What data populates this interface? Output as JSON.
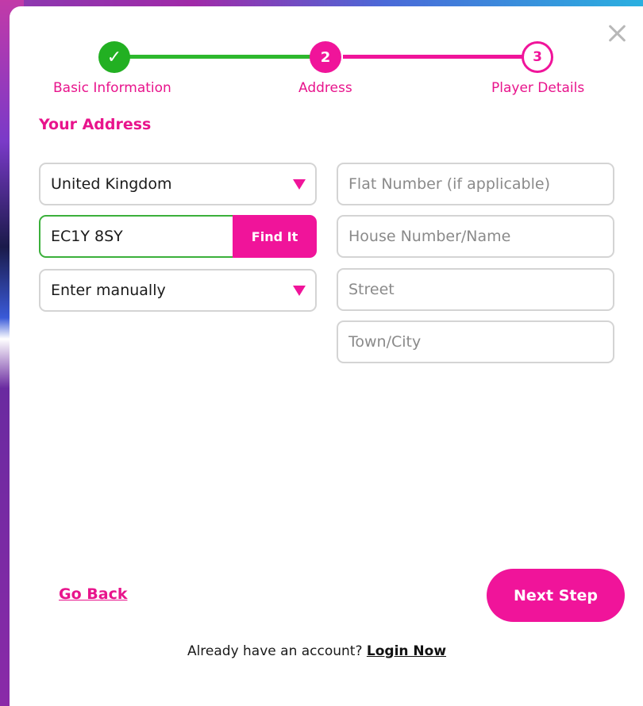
{
  "stepper": {
    "steps": [
      {
        "number": "✓",
        "label": "Basic Information",
        "state": "complete"
      },
      {
        "number": "2",
        "label": "Address",
        "state": "active"
      },
      {
        "number": "3",
        "label": "Player Details",
        "state": "upcoming"
      }
    ]
  },
  "section_title": "Your Address",
  "form": {
    "country_value": "United Kingdom",
    "postcode_value": "EC1Y 8SY",
    "find_button_label": "Find It",
    "address_select_value": "Enter manually",
    "flat_placeholder": "Flat Number (if applicable)",
    "house_placeholder": "House Number/Name",
    "street_placeholder": "Street",
    "town_placeholder": "Town/City"
  },
  "actions": {
    "go_back_label": "Go Back",
    "next_label": "Next Step"
  },
  "footer": {
    "prompt": "Already have an account?",
    "login_label": "Login Now"
  },
  "colors": {
    "accent_pink": "#f0149a",
    "success_green": "#22b022",
    "border_gray": "#d4d4d4"
  },
  "icons": {
    "close": "close-icon",
    "check": "check-icon",
    "dropdown": "chevron-down-icon"
  }
}
